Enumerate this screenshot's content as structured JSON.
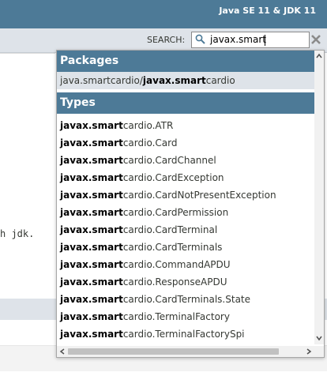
{
  "header": {
    "about": "Java SE 11 & JDK 11"
  },
  "search": {
    "label": "SEARCH:",
    "value": "javax.smart"
  },
  "background": {
    "fragment": "h jdk."
  },
  "dropdown": {
    "packages_heading": "Packages",
    "packages": [
      {
        "prefix": "java.smartcardio/",
        "match": "javax.smart",
        "suffix": "cardio"
      }
    ],
    "types_heading": "Types",
    "types": [
      {
        "match": "javax.smart",
        "suffix": "cardio.ATR"
      },
      {
        "match": "javax.smart",
        "suffix": "cardio.Card"
      },
      {
        "match": "javax.smart",
        "suffix": "cardio.CardChannel"
      },
      {
        "match": "javax.smart",
        "suffix": "cardio.CardException"
      },
      {
        "match": "javax.smart",
        "suffix": "cardio.CardNotPresentException"
      },
      {
        "match": "javax.smart",
        "suffix": "cardio.CardPermission"
      },
      {
        "match": "javax.smart",
        "suffix": "cardio.CardTerminal"
      },
      {
        "match": "javax.smart",
        "suffix": "cardio.CardTerminals"
      },
      {
        "match": "javax.smart",
        "suffix": "cardio.CommandAPDU"
      },
      {
        "match": "javax.smart",
        "suffix": "cardio.ResponseAPDU"
      },
      {
        "match": "javax.smart",
        "suffix": "cardio.CardTerminals.State"
      },
      {
        "match": "javax.smart",
        "suffix": "cardio.TerminalFactory"
      },
      {
        "match": "javax.smart",
        "suffix": "cardio.TerminalFactorySpi"
      }
    ]
  },
  "colors": {
    "header_bg": "#4d7a97",
    "subnav_bg": "#dee3e9",
    "selected_row": "#dee3e9"
  },
  "icons": [
    "magnifier-icon",
    "reset-x-icon",
    "scroll-arrow-icons"
  ]
}
